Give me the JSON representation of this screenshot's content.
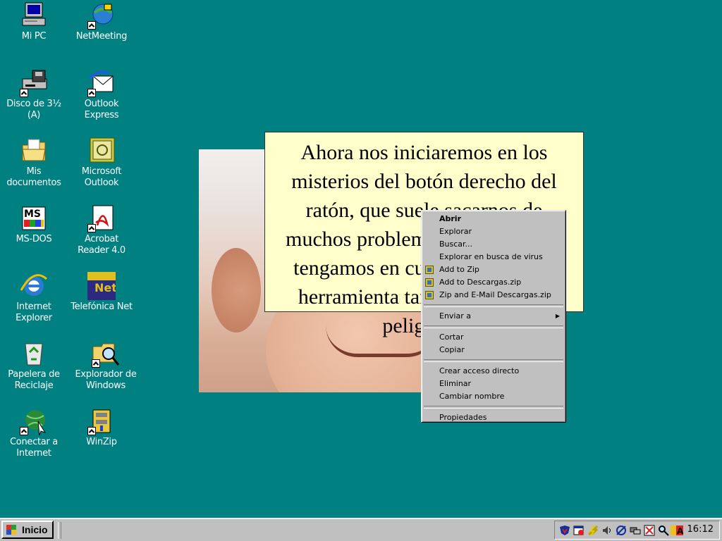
{
  "desktop": {
    "icons": [
      {
        "label": "Mi PC",
        "icon": "my-computer-icon"
      },
      {
        "label": "NetMeeting",
        "icon": "netmeeting-icon"
      },
      {
        "label": "Disco de 3½\n(A)",
        "icon": "floppy-drive-icon"
      },
      {
        "label": "Outlook\nExpress",
        "icon": "outlook-express-icon"
      },
      {
        "label": "Mis\ndocumentos",
        "icon": "my-documents-icon"
      },
      {
        "label": "Microsoft\nOutlook",
        "icon": "microsoft-outlook-icon"
      },
      {
        "label": "MS-DOS",
        "icon": "ms-dos-icon"
      },
      {
        "label": "Acrobat\nReader 4.0",
        "icon": "acrobat-reader-icon"
      },
      {
        "label": "Internet\nExplorer",
        "icon": "internet-explorer-icon"
      },
      {
        "label": "Telefónica Net",
        "icon": "telefonica-net-icon"
      },
      {
        "label": "Papelera de\nReciclaje",
        "icon": "recycle-bin-icon"
      },
      {
        "label": "Explorador de\nWindows",
        "icon": "windows-explorer-icon"
      },
      {
        "label": "Conectar a\nInternet",
        "icon": "connect-internet-icon"
      },
      {
        "label": "WinZip",
        "icon": "winzip-icon"
      }
    ]
  },
  "slide": {
    "text": "Ahora nos iniciaremos en los misterios del botón derecho del ratón, que suele sacarnos de muchos problemas. Sin embargo tengamos en cuenta que es una herramienta tan potente como peligrosa:"
  },
  "context_menu": {
    "groups": [
      [
        "Abrir",
        "Explorar",
        "Buscar...",
        "Explorar en busca de virus",
        "Add to Zip",
        "Add to Descargas.zip",
        "Zip and E-Mail Descargas.zip"
      ],
      [
        "Enviar a"
      ],
      [
        "Cortar",
        "Copiar"
      ],
      [
        "Crear acceso directo",
        "Eliminar",
        "Cambiar nombre"
      ],
      [
        "Propiedades"
      ]
    ]
  },
  "taskbar": {
    "start_label": "Inicio",
    "clock": "16:12",
    "tray_icons": [
      "antivirus-shield-icon",
      "scheduler-icon",
      "power-icon",
      "volume-icon",
      "network-icon",
      "link-icon",
      "virus-scan-icon",
      "search-icon",
      "spelling-icon"
    ]
  },
  "colors": {
    "desktop": "#008080",
    "menu_bg": "#c0c0c0",
    "message_bg": "#ffffcc"
  }
}
